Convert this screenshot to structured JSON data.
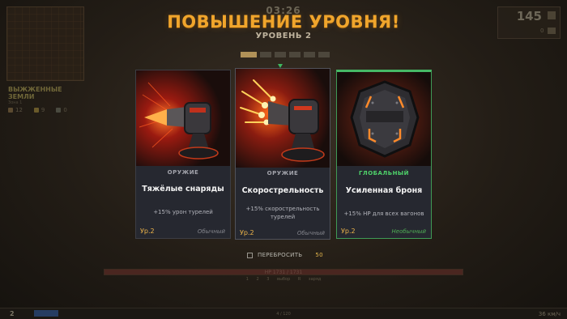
{
  "hud": {
    "timer": "03:26",
    "zone_name": "ВЫЖЖЕННЫЕ ЗЕМЛИ",
    "zone_sub": "Зона 1",
    "resources": [
      "12",
      "9",
      "0"
    ],
    "score": "145",
    "score_small": "0",
    "hp_text": "HP 1731 / 1731",
    "ammo": [
      "1",
      "2",
      "3",
      "выбор",
      "R",
      "заряд"
    ],
    "level": "2",
    "xp_text": "4 / 120",
    "speed": "36 км/ч"
  },
  "modal": {
    "title": "ПОВЫШЕНИЕ УРОВНЯ!",
    "subtitle": "УРОВЕНЬ 2",
    "pips_total": 6,
    "pip_active_index": 0
  },
  "cards": [
    {
      "category": "ОРУЖИЕ",
      "name": "Тяжёлые снаряды",
      "description": "+15% урон турелей",
      "level": "Ур.2",
      "rarity": "Обычный",
      "art_icon": "heavy-shell-turret-icon"
    },
    {
      "category": "ОРУЖИЕ",
      "name": "Скорострельность",
      "description": "+15% скорострельность турелей",
      "level": "Ур.2",
      "rarity": "Обычный",
      "art_icon": "rapid-fire-turret-icon"
    },
    {
      "category": "ГЛОБАЛЬНЫЙ",
      "name": "Усиленная броня",
      "description": "+15% HP для всех вагонов",
      "level": "Ур.2",
      "rarity": "Необычный",
      "art_icon": "armor-plate-icon"
    }
  ],
  "reroll": {
    "label": "ПЕРЕБРОСИТЬ",
    "cost": "50"
  },
  "colors": {
    "title": "#f0a52c",
    "global": "#4fd36a",
    "level": "#f0b64a",
    "uncommon": "#4fae55",
    "card_bg": "#262830"
  }
}
